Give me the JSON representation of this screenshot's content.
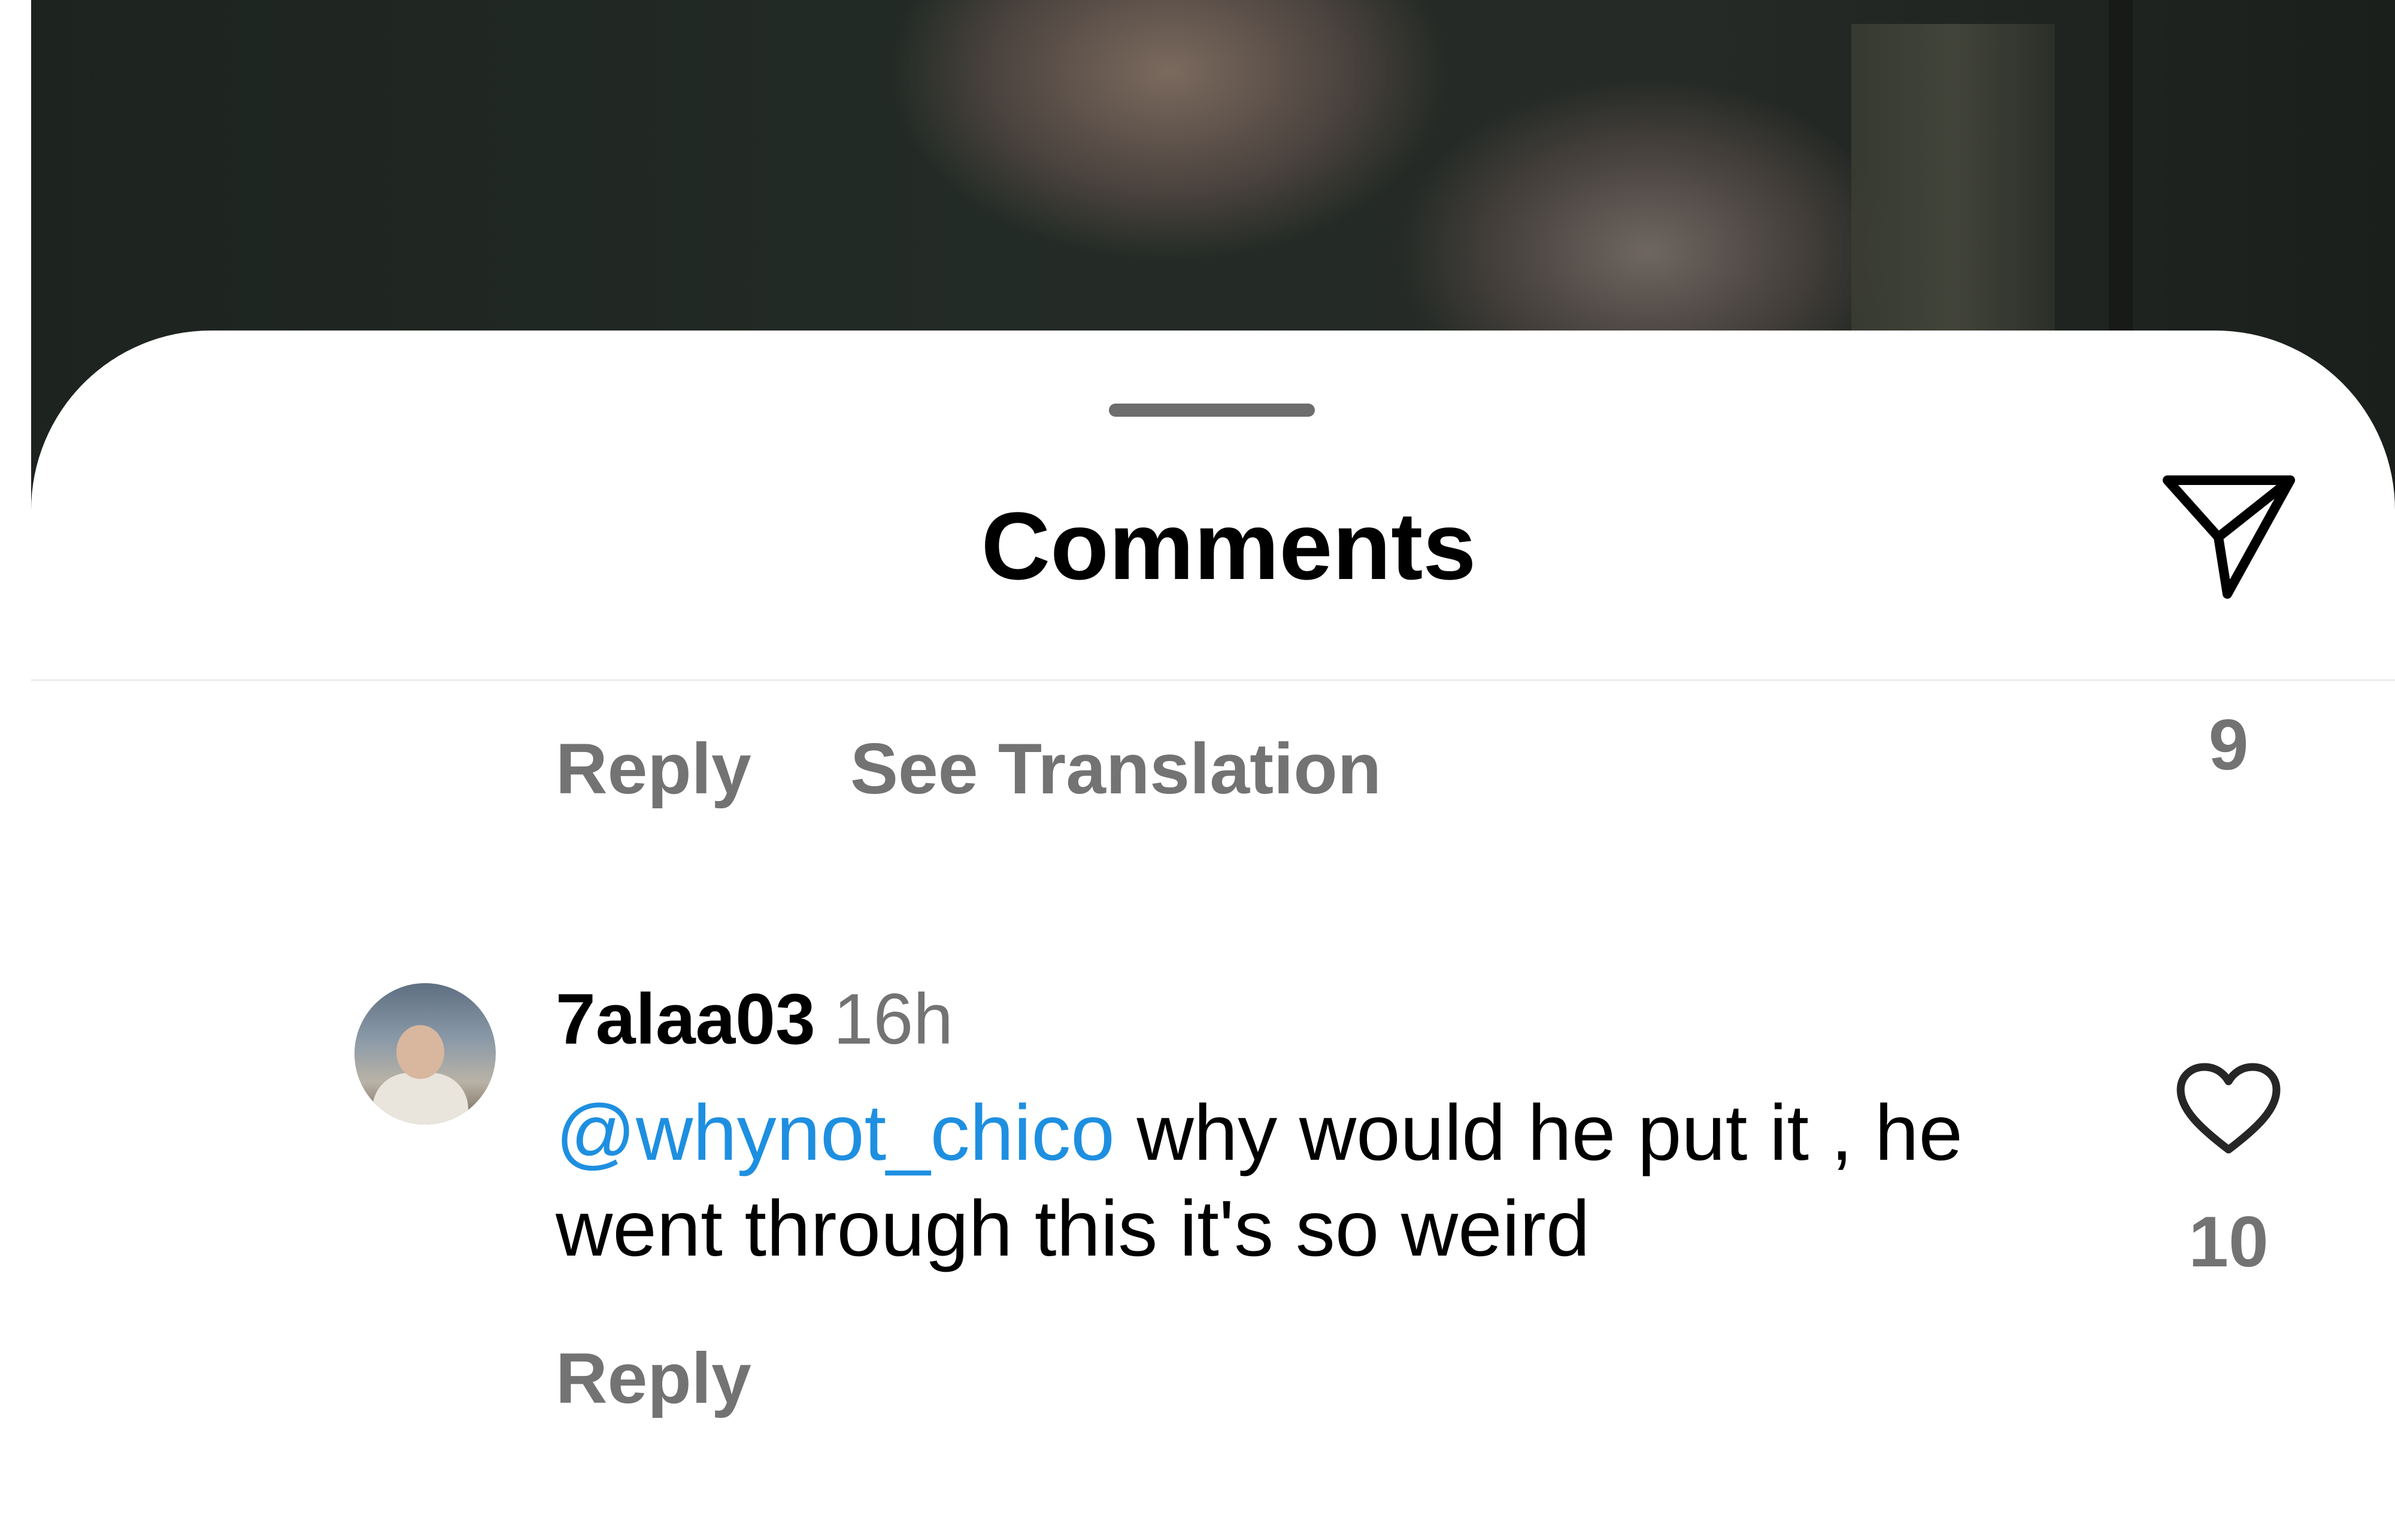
{
  "sheet": {
    "title": "Comments",
    "share_icon": "send-paper-plane-icon",
    "grabber_icon": "drag-handle-icon"
  },
  "previous_comment": {
    "reply_label": "Reply",
    "translation_label": "See Translation",
    "like_count": "9"
  },
  "comment": {
    "avatar_icon": "user-avatar",
    "username": "7alaa03",
    "timestamp": "16h",
    "mention": "@whynot_chico",
    "text": " why would he put it , he went through this it's so weird",
    "like_icon": "heart-outline-icon",
    "like_count": "10",
    "reply_label": "Reply"
  },
  "colors": {
    "mention": "#1e8fe0",
    "secondary_text": "#737373",
    "primary_text": "#000000",
    "sheet_background": "#ffffff"
  }
}
